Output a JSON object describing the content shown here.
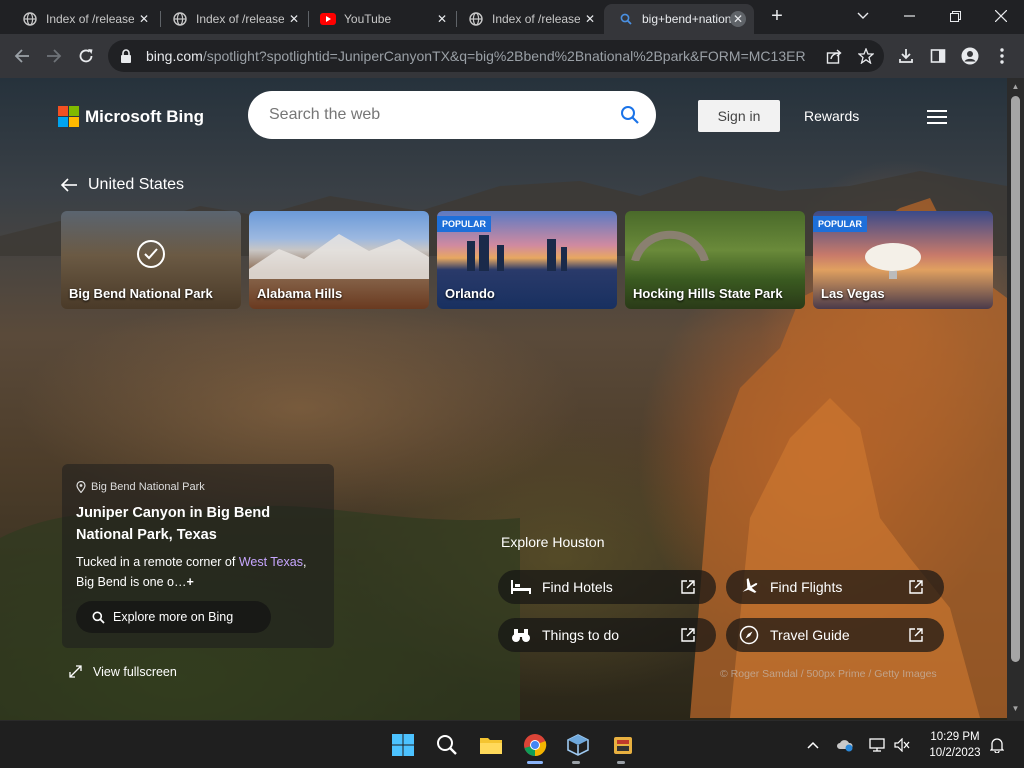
{
  "browser": {
    "tabs": [
      {
        "title": "Index of /releases",
        "icon": "globe-icon"
      },
      {
        "title": "Index of /releases",
        "icon": "globe-icon"
      },
      {
        "title": "YouTube",
        "icon": "youtube-icon"
      },
      {
        "title": "Index of /releases",
        "icon": "globe-icon"
      },
      {
        "title": "big+bend+national",
        "icon": "search-icon",
        "active": true
      }
    ],
    "url_host": "bing.com",
    "url_path": "/spotlight?spotlightid=JuniperCanyonTX&q=big%2Bbend%2Bnational%2Bpark&FORM=MC13ER"
  },
  "bing": {
    "brand": "Microsoft Bing",
    "search_placeholder": "Search the web",
    "sign_in": "Sign in",
    "rewards": "Rewards",
    "region": "United States",
    "cards": [
      {
        "label": "Big Bend National Park",
        "selected": true,
        "popular": ""
      },
      {
        "label": "Alabama Hills",
        "popular": ""
      },
      {
        "label": "Orlando",
        "popular": "POPULAR"
      },
      {
        "label": "Hocking Hills State Park",
        "popular": ""
      },
      {
        "label": "Las Vegas",
        "popular": "POPULAR"
      }
    ],
    "info": {
      "location": "Big Bend National Park",
      "title": "Juniper Canyon in Big Bend National Park, Texas",
      "desc_prefix": "Tucked in a remote corner of ",
      "desc_link": "West Texas",
      "desc_suffix": ", Big Bend is one o…",
      "more": "+",
      "explore_button": "Explore more on Bing"
    },
    "view_fullscreen": "View fullscreen",
    "explore_heading": "Explore Houston",
    "explore_links": [
      {
        "label": "Find Hotels",
        "icon": "bed-icon"
      },
      {
        "label": "Find Flights",
        "icon": "airplane-icon"
      },
      {
        "label": "Things to do",
        "icon": "binoculars-icon"
      },
      {
        "label": "Travel Guide",
        "icon": "compass-icon"
      }
    ],
    "credit": "© Roger Samdal / 500px Prime / Getty Images"
  },
  "taskbar": {
    "time": "10:29 PM",
    "date": "10/2/2023"
  },
  "colors": {
    "accent_link": "#c7a6ff",
    "popular_badge": "#1e6fd9",
    "search_icon": "#1a73e8"
  }
}
